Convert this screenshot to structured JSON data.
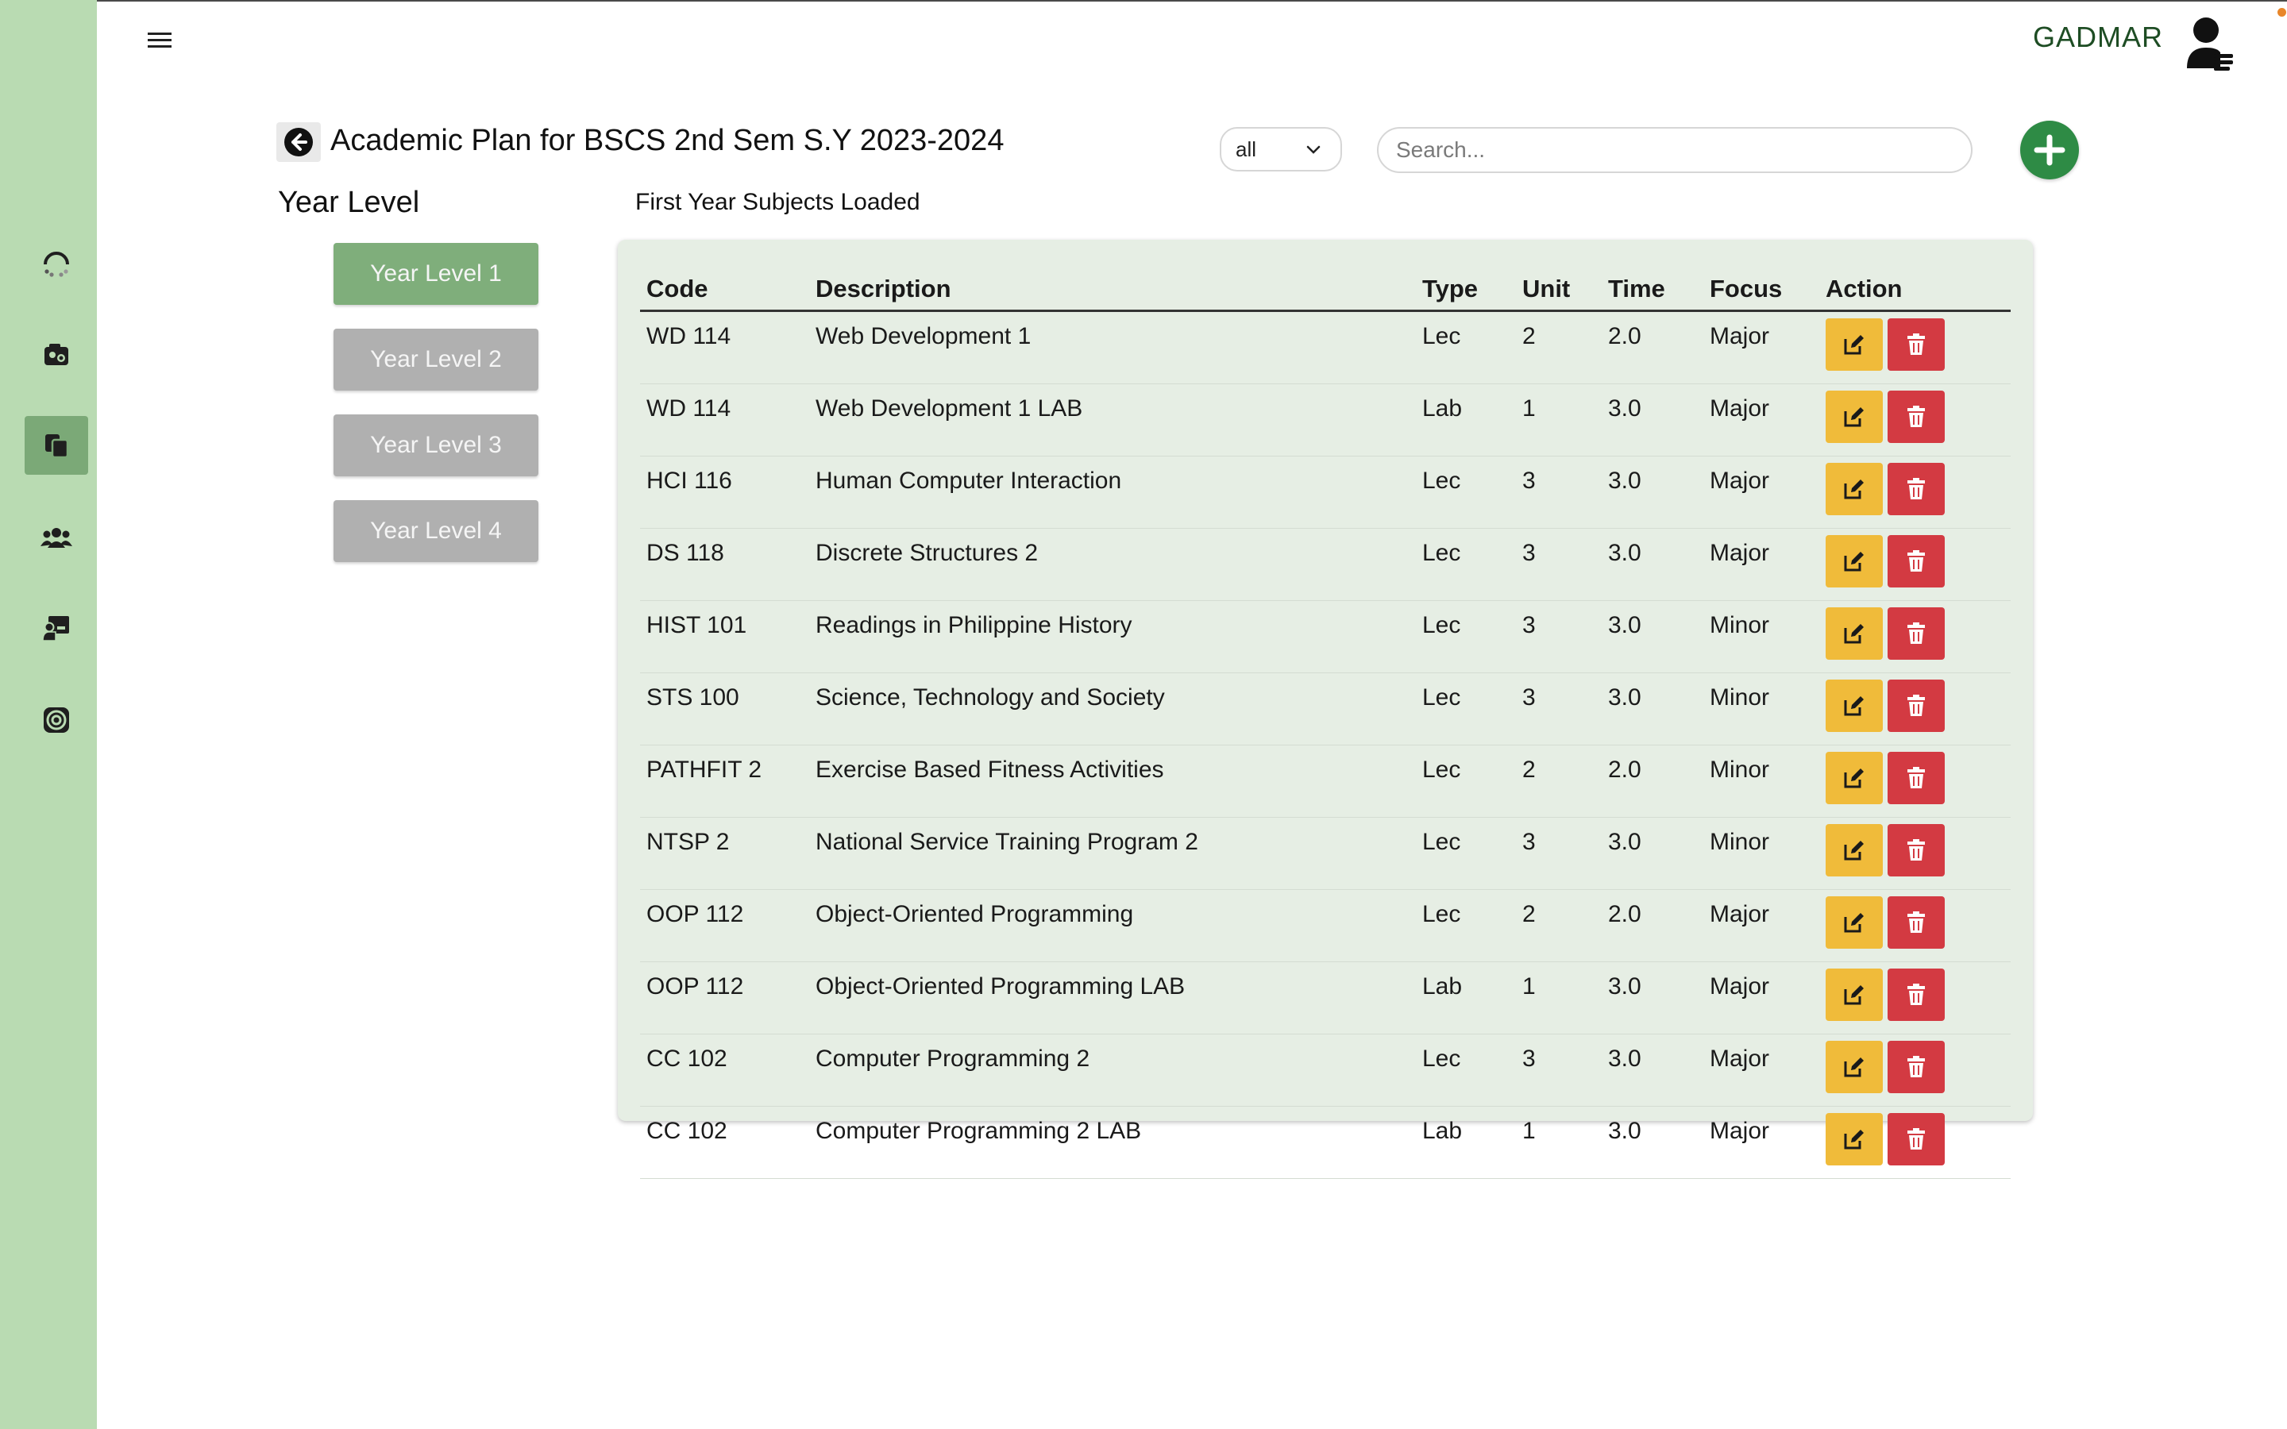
{
  "header": {
    "brand": "GADMAR"
  },
  "page": {
    "title": "Academic Plan for BSCS 2nd Sem S.Y 2023-2024"
  },
  "filter": {
    "selected": "all"
  },
  "search": {
    "placeholder": "Search..."
  },
  "year_section": {
    "heading": "Year Level",
    "buttons": [
      "Year Level 1",
      "Year Level 2",
      "Year Level 3",
      "Year Level 4"
    ],
    "active_index": 0
  },
  "subjects_label": "First Year Subjects Loaded",
  "table": {
    "columns": [
      "Code",
      "Description",
      "Type",
      "Unit",
      "Time",
      "Focus",
      "Action"
    ],
    "rows": [
      [
        "WD 114",
        "Web Development 1",
        "Lec",
        "2",
        "2.0",
        "Major"
      ],
      [
        "WD 114",
        "Web Development 1 LAB",
        "Lab",
        "1",
        "3.0",
        "Major"
      ],
      [
        "HCI 116",
        "Human Computer Interaction",
        "Lec",
        "3",
        "3.0",
        "Major"
      ],
      [
        "DS 118",
        "Discrete Structures 2",
        "Lec",
        "3",
        "3.0",
        "Major"
      ],
      [
        "HIST 101",
        "Readings in Philippine History",
        "Lec",
        "3",
        "3.0",
        "Minor"
      ],
      [
        "STS 100",
        "Science, Technology and Society",
        "Lec",
        "3",
        "3.0",
        "Minor"
      ],
      [
        "PATHFIT 2",
        "Exercise Based Fitness Activities",
        "Lec",
        "2",
        "2.0",
        "Minor"
      ],
      [
        "NTSP 2",
        "National Service Training Program 2",
        "Lec",
        "3",
        "3.0",
        "Minor"
      ],
      [
        "OOP 112",
        "Object-Oriented Programming",
        "Lec",
        "2",
        "2.0",
        "Major"
      ],
      [
        "OOP 112",
        "Object-Oriented Programming LAB",
        "Lab",
        "1",
        "3.0",
        "Major"
      ],
      [
        "CC 102",
        "Computer Programming 2",
        "Lec",
        "3",
        "3.0",
        "Major"
      ],
      [
        "CC 102",
        "Computer Programming 2 LAB",
        "Lab",
        "1",
        "3.0",
        "Major"
      ]
    ]
  },
  "sidebar": {
    "items": [
      {
        "icon": "loading-icon"
      },
      {
        "icon": "dashboard-icon"
      },
      {
        "icon": "copy-icon",
        "active": true
      },
      {
        "icon": "users-icon"
      },
      {
        "icon": "chalkboard-teacher-icon"
      },
      {
        "icon": "settings-circle-icon"
      }
    ]
  },
  "colors": {
    "sidebar": "#b9dbb2",
    "active": "#7fae7b",
    "edit": "#f0bb3a",
    "delete": "#d33a42",
    "add": "#2e8b45"
  }
}
